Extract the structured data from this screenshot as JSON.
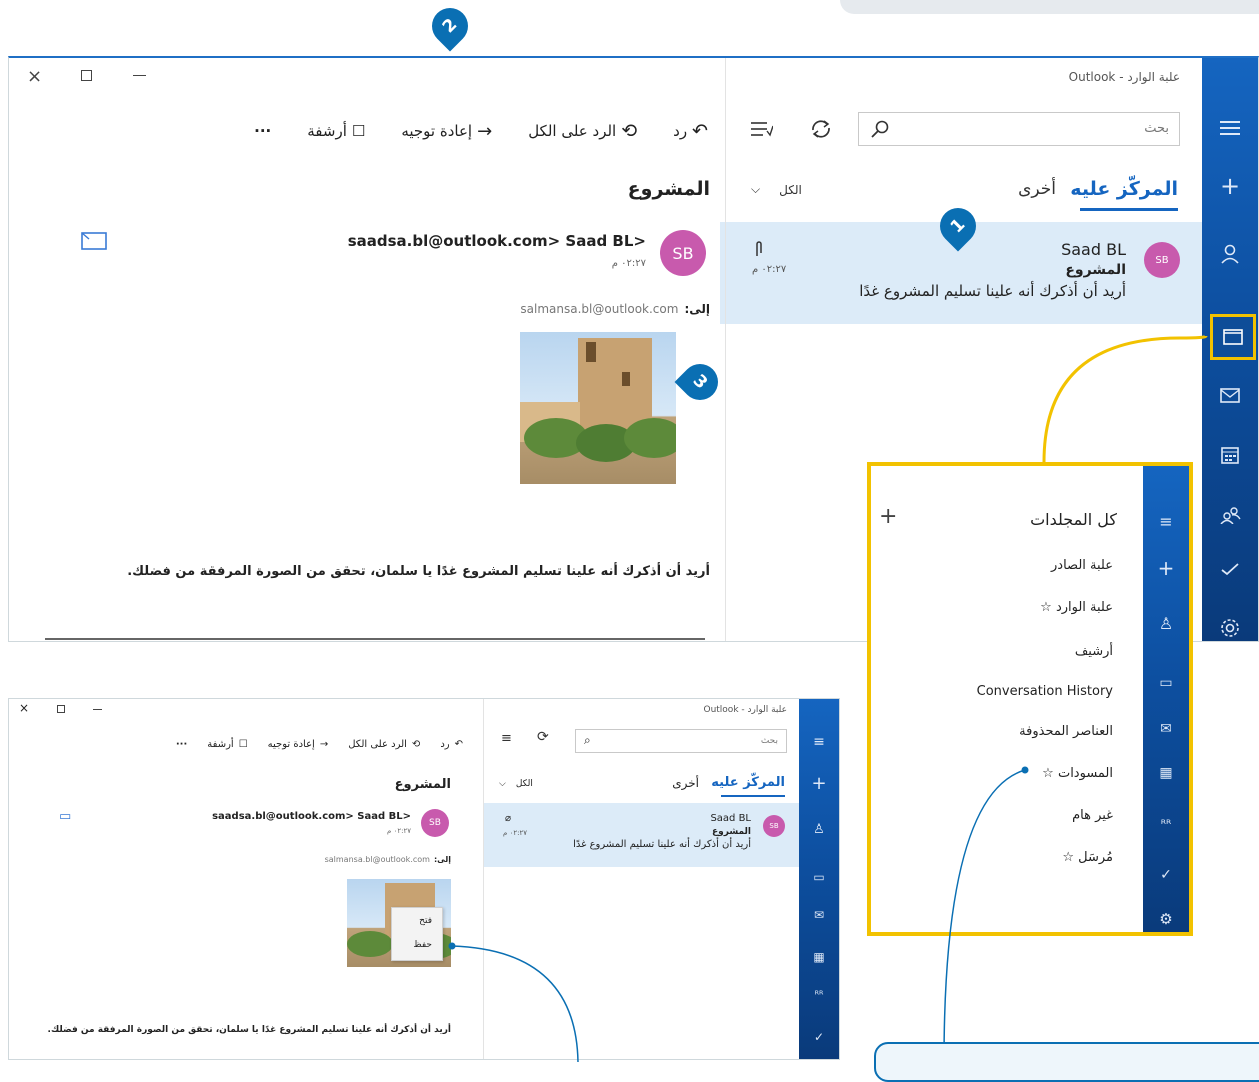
{
  "main_window": {
    "title": "علبة الوارد - Outlook",
    "search_placeholder": "بحث",
    "tab_focused": "المركّز عليه",
    "tab_other": "أخرى",
    "filter_label": "الكل",
    "message": {
      "sender": "Saad BL",
      "initials": "SB",
      "subject": "المشروع",
      "preview": "أريد أن أذكرك أنه علينا تسليم المشروع غدًا",
      "time": "٠٢:٢٧ م"
    },
    "toolbar": {
      "reply": "رد",
      "reply_all": "الرد على الكل",
      "forward": "إعادة توجيه",
      "archive": "أرشفة",
      "more": "···"
    },
    "reading": {
      "subject": "المشروع",
      "from": "<saadsa.bl@outlook.com> Saad BL",
      "initials": "SB",
      "time": "٠٢:٢٧ م",
      "to_label": "إلى:",
      "to_address": "salmansa.bl@outlook.com",
      "body": "أريد أن أذكرك أنه علينا تسليم المشروع غدًا يا سلمان، تحقق من الصورة المرفقة من فضلك."
    }
  },
  "folders_panel": {
    "title": "كل المجلدات",
    "add": "+",
    "items": [
      "علبة الصادر",
      "علبة الوارد ☆",
      "أرشيف",
      "Conversation History",
      "العناصر المحذوفة",
      "المسودات ☆",
      "غير هام",
      "مُرسَل ☆"
    ]
  },
  "small_window": {
    "title": "علبة الوارد - Outlook",
    "search_placeholder": "بحث",
    "tab_focused": "المركّز عليه",
    "tab_other": "أخرى",
    "filter_label": "الكل",
    "message": {
      "sender": "Saad BL",
      "initials": "SB",
      "subject": "المشروع",
      "preview": "أريد أن أذكرك أنه علينا تسليم المشروع غدًا",
      "time": "٠٢:٢٧ م"
    },
    "toolbar": {
      "reply": "رد",
      "reply_all": "الرد على الكل",
      "forward": "إعادة توجيه",
      "archive": "أرشفة",
      "more": "···"
    },
    "reading": {
      "subject": "المشروع",
      "from": "<saadsa.bl@outlook.com> Saad BL",
      "initials": "SB",
      "time": "٠٢:٢٧ م",
      "to_label": "إلى:",
      "to_address": "salmansa.bl@outlook.com",
      "body": "أريد أن أذكرك أنه علينا تسليم المشروع غدًا يا سلمان، تحقق من الصورة المرفقة من فضلك."
    },
    "context_menu": {
      "open": "فتح",
      "save": "حفظ"
    }
  },
  "callouts": {
    "one": "1",
    "two": "2",
    "three": "3"
  },
  "colors": {
    "accent": "#1565c0",
    "callout": "#0a6fb3",
    "highlight": "#f2c200",
    "selected_row": "#dcebf8",
    "avatar": "#c85aad"
  }
}
